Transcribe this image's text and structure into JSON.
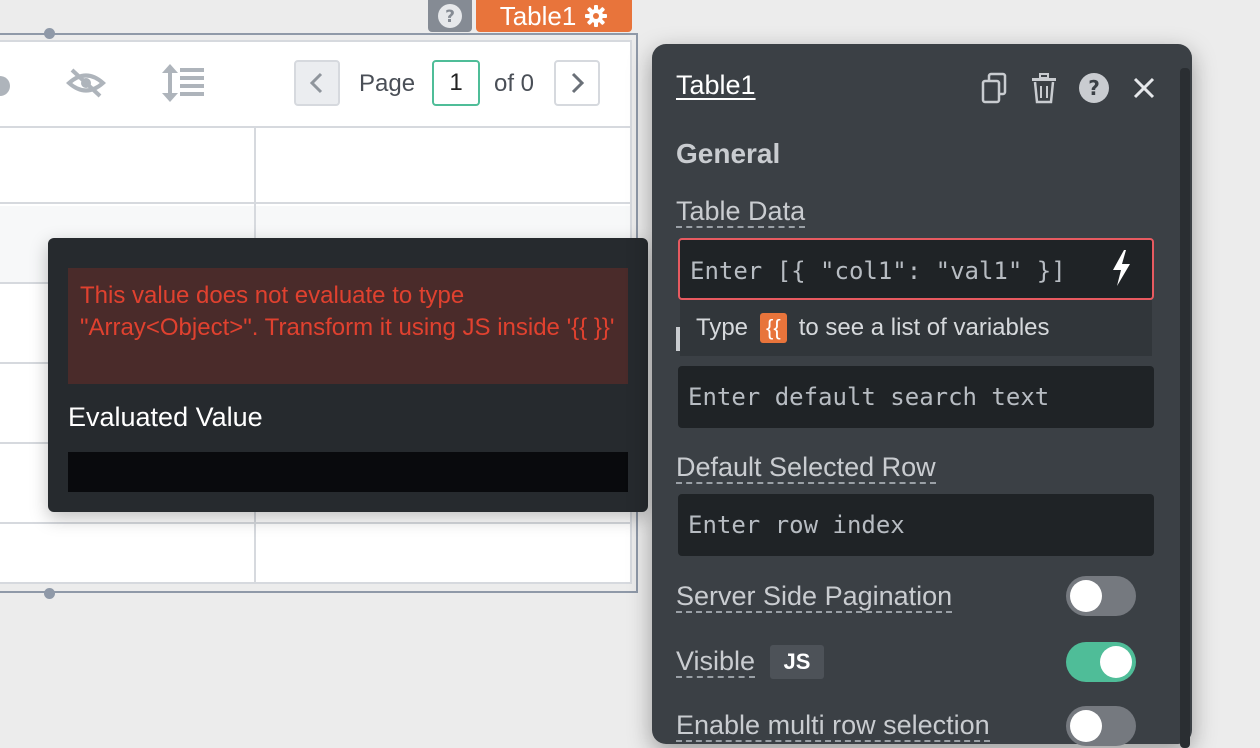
{
  "canvas": {
    "widget_name": "Table1",
    "pagination": {
      "page_label": "Page",
      "page_value": "1",
      "of_label": "of 0"
    }
  },
  "error_popover": {
    "message": "This value does not evaluate to type \"Array<Object>\". Transform it using JS inside '{{ }}'",
    "evaluated_value_title": "Evaluated Value",
    "evaluated_value": ""
  },
  "property_pane": {
    "title": "Table1",
    "section_general": "General",
    "table_data": {
      "label": "Table Data",
      "placeholder": "Enter [{ \"col1\": \"val1\" }]"
    },
    "hint": {
      "prefix": "Type",
      "brace": "{{",
      "suffix": "to see a list of variables"
    },
    "default_search": {
      "placeholder": "Enter default search text"
    },
    "default_selected_row": {
      "label": "Default Selected Row",
      "placeholder": "Enter row index"
    },
    "server_side_pagination": {
      "label": "Server Side Pagination",
      "enabled": false
    },
    "visible": {
      "label": "Visible",
      "badge": "JS",
      "enabled": true
    },
    "enable_multi_row_selection": {
      "label": "Enable multi row selection",
      "enabled": false
    }
  },
  "colors": {
    "accent_orange": "#e8743b",
    "toggle_on": "#4fbd98",
    "error_text": "#e0412f",
    "pane_bg": "#3b4045"
  }
}
